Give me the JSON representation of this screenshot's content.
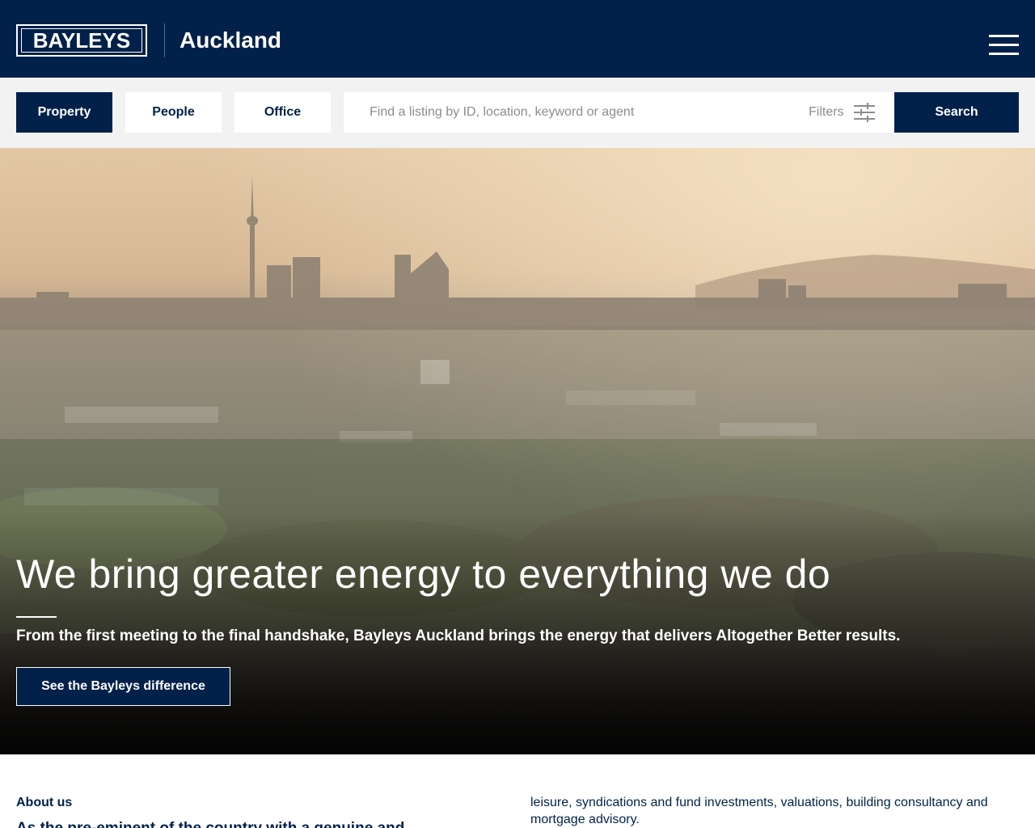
{
  "header": {
    "logo_text": "BAYLEYS",
    "office_name": "Auckland",
    "menu_icon": "hamburger-menu-icon"
  },
  "search": {
    "tabs": [
      {
        "label": "Property",
        "active": true
      },
      {
        "label": "People",
        "active": false
      },
      {
        "label": "Office",
        "active": false
      }
    ],
    "placeholder": "Find a listing by ID, location, keyword or agent",
    "filters_label": "Filters",
    "filters_icon": "sliders-icon",
    "button_label": "Search"
  },
  "hero": {
    "title": "We bring greater energy to everything we do",
    "subtitle": "From the first meeting to the final handshake, Bayleys Auckland brings the energy that delivers Altogether Better results.",
    "button_label": "See the Bayleys difference"
  },
  "about": {
    "heading": "About us",
    "lead": "As the pre-eminent of the country with a genuine and",
    "body": "leisure, syndications and fund investments, valuations, building consultancy and mortgage advisory."
  },
  "colors": {
    "brand_navy": "#01214a",
    "search_bg": "#f2f2f2",
    "white": "#ffffff"
  }
}
